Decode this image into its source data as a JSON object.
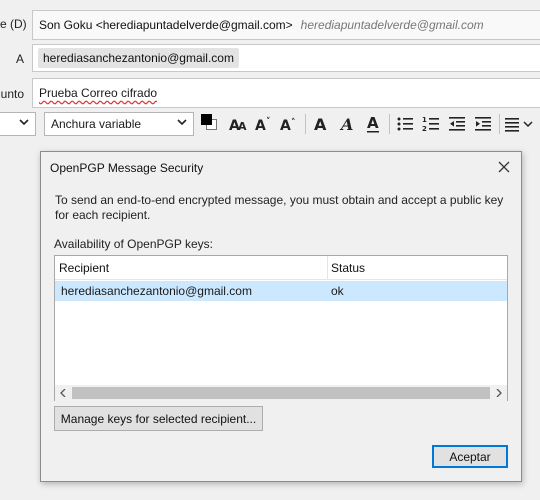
{
  "compose": {
    "from_label": "e (D)",
    "from_value": "Son Goku <herediapuntadelverde@gmail.com>",
    "from_alias": "herediapuntadelverde@gmail.com",
    "to_label": "A",
    "to_recipient": "herediasanchezantonio@gmail.com",
    "subject_label": "unto",
    "subject_value": "Prueba Correo cifrado"
  },
  "toolbar": {
    "paragraph_select": "",
    "font_select": "Anchura variable",
    "text_color": "#000000",
    "background_color": "#ffffff",
    "buttons": {
      "smaller_size": "A",
      "smaller_a": "A",
      "larger_size": "A",
      "bold": "A",
      "italic": "A",
      "underline": "A"
    }
  },
  "dialog": {
    "title": "OpenPGP Message Security",
    "message": "To send an end-to-end encrypted message, you must obtain and accept a public key for each recipient.",
    "availability_label": "Availability of OpenPGP keys:",
    "columns": [
      "Recipient",
      "Status"
    ],
    "rows": [
      {
        "recipient": "herediasanchezantonio@gmail.com",
        "status": "ok"
      }
    ],
    "manage_button": "Manage keys for selected recipient...",
    "ok_button": "Aceptar"
  },
  "colors": {
    "selection": "#cce8ff",
    "accent": "#0078d7"
  }
}
